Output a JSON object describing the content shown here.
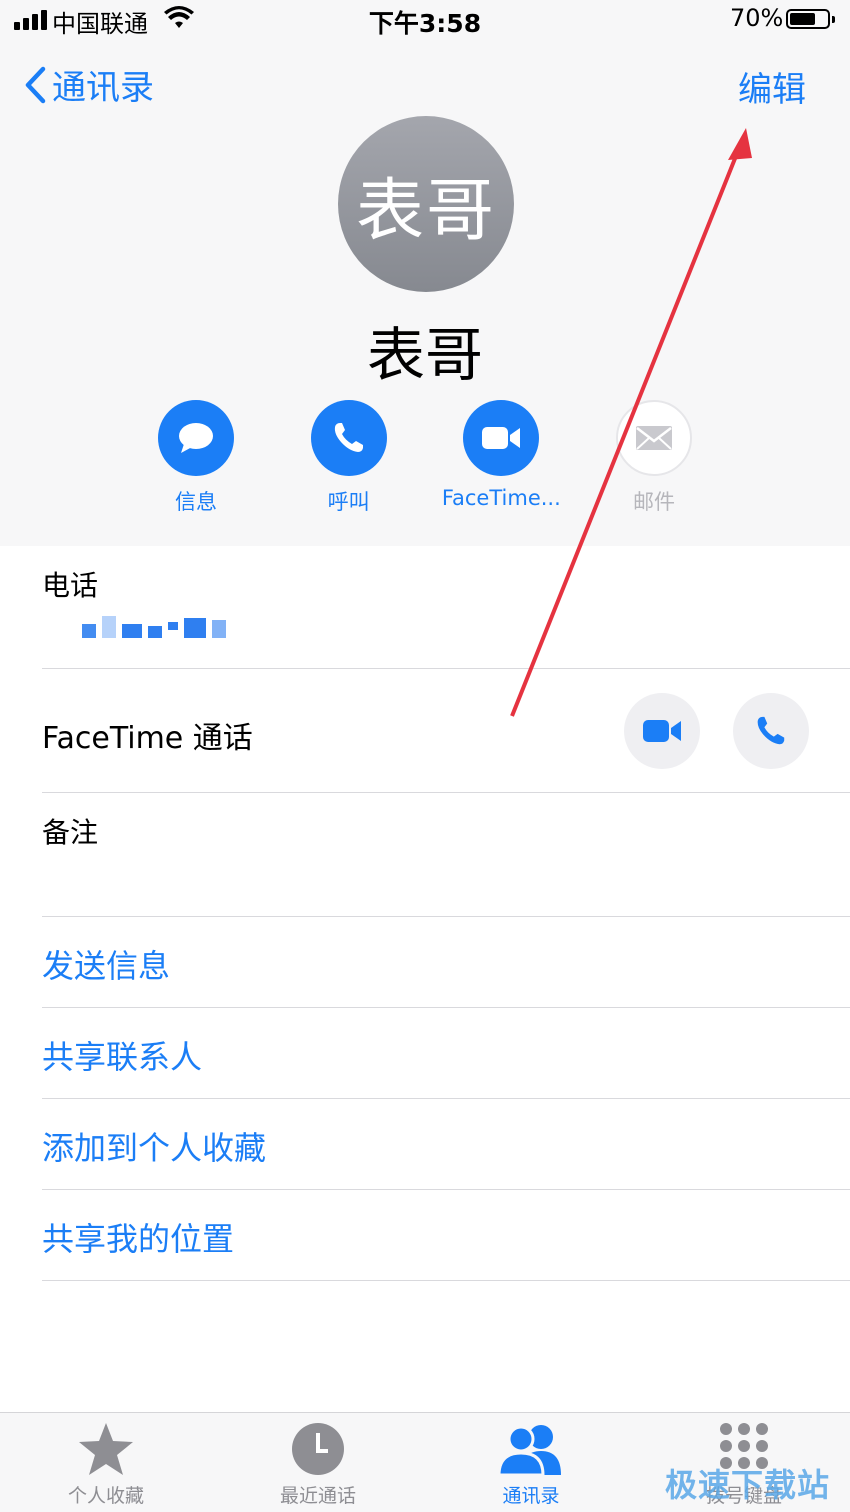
{
  "status_bar": {
    "carrier": "中国联通",
    "time": "下午3:58",
    "battery_pct": "70%",
    "battery_level": 0.7
  },
  "nav": {
    "back_label": "通讯录",
    "edit_label": "编辑"
  },
  "contact": {
    "avatar_text": "表哥",
    "name": "表哥"
  },
  "actions": [
    {
      "label": "信息",
      "icon": "message-icon"
    },
    {
      "label": "呼叫",
      "icon": "phone-icon"
    },
    {
      "label": "FaceTime...",
      "icon": "video-icon"
    },
    {
      "label": "邮件",
      "icon": "mail-icon",
      "disabled": true
    }
  ],
  "rows": {
    "phone_label": "电话",
    "facetime_label": "FaceTime 通话",
    "notes_label": "备注"
  },
  "links": [
    "发送信息",
    "共享联系人",
    "添加到个人收藏",
    "共享我的位置"
  ],
  "tabbar": [
    {
      "label": "个人收藏",
      "icon": "star-icon"
    },
    {
      "label": "最近通话",
      "icon": "clock-icon"
    },
    {
      "label": "通讯录",
      "icon": "contacts-icon",
      "active": true
    },
    {
      "label": "拨号键盘",
      "icon": "keypad-icon"
    }
  ],
  "watermark": "极速下载站",
  "colors": {
    "accent": "#1b7ef6",
    "annotation_arrow": "#e53340"
  }
}
